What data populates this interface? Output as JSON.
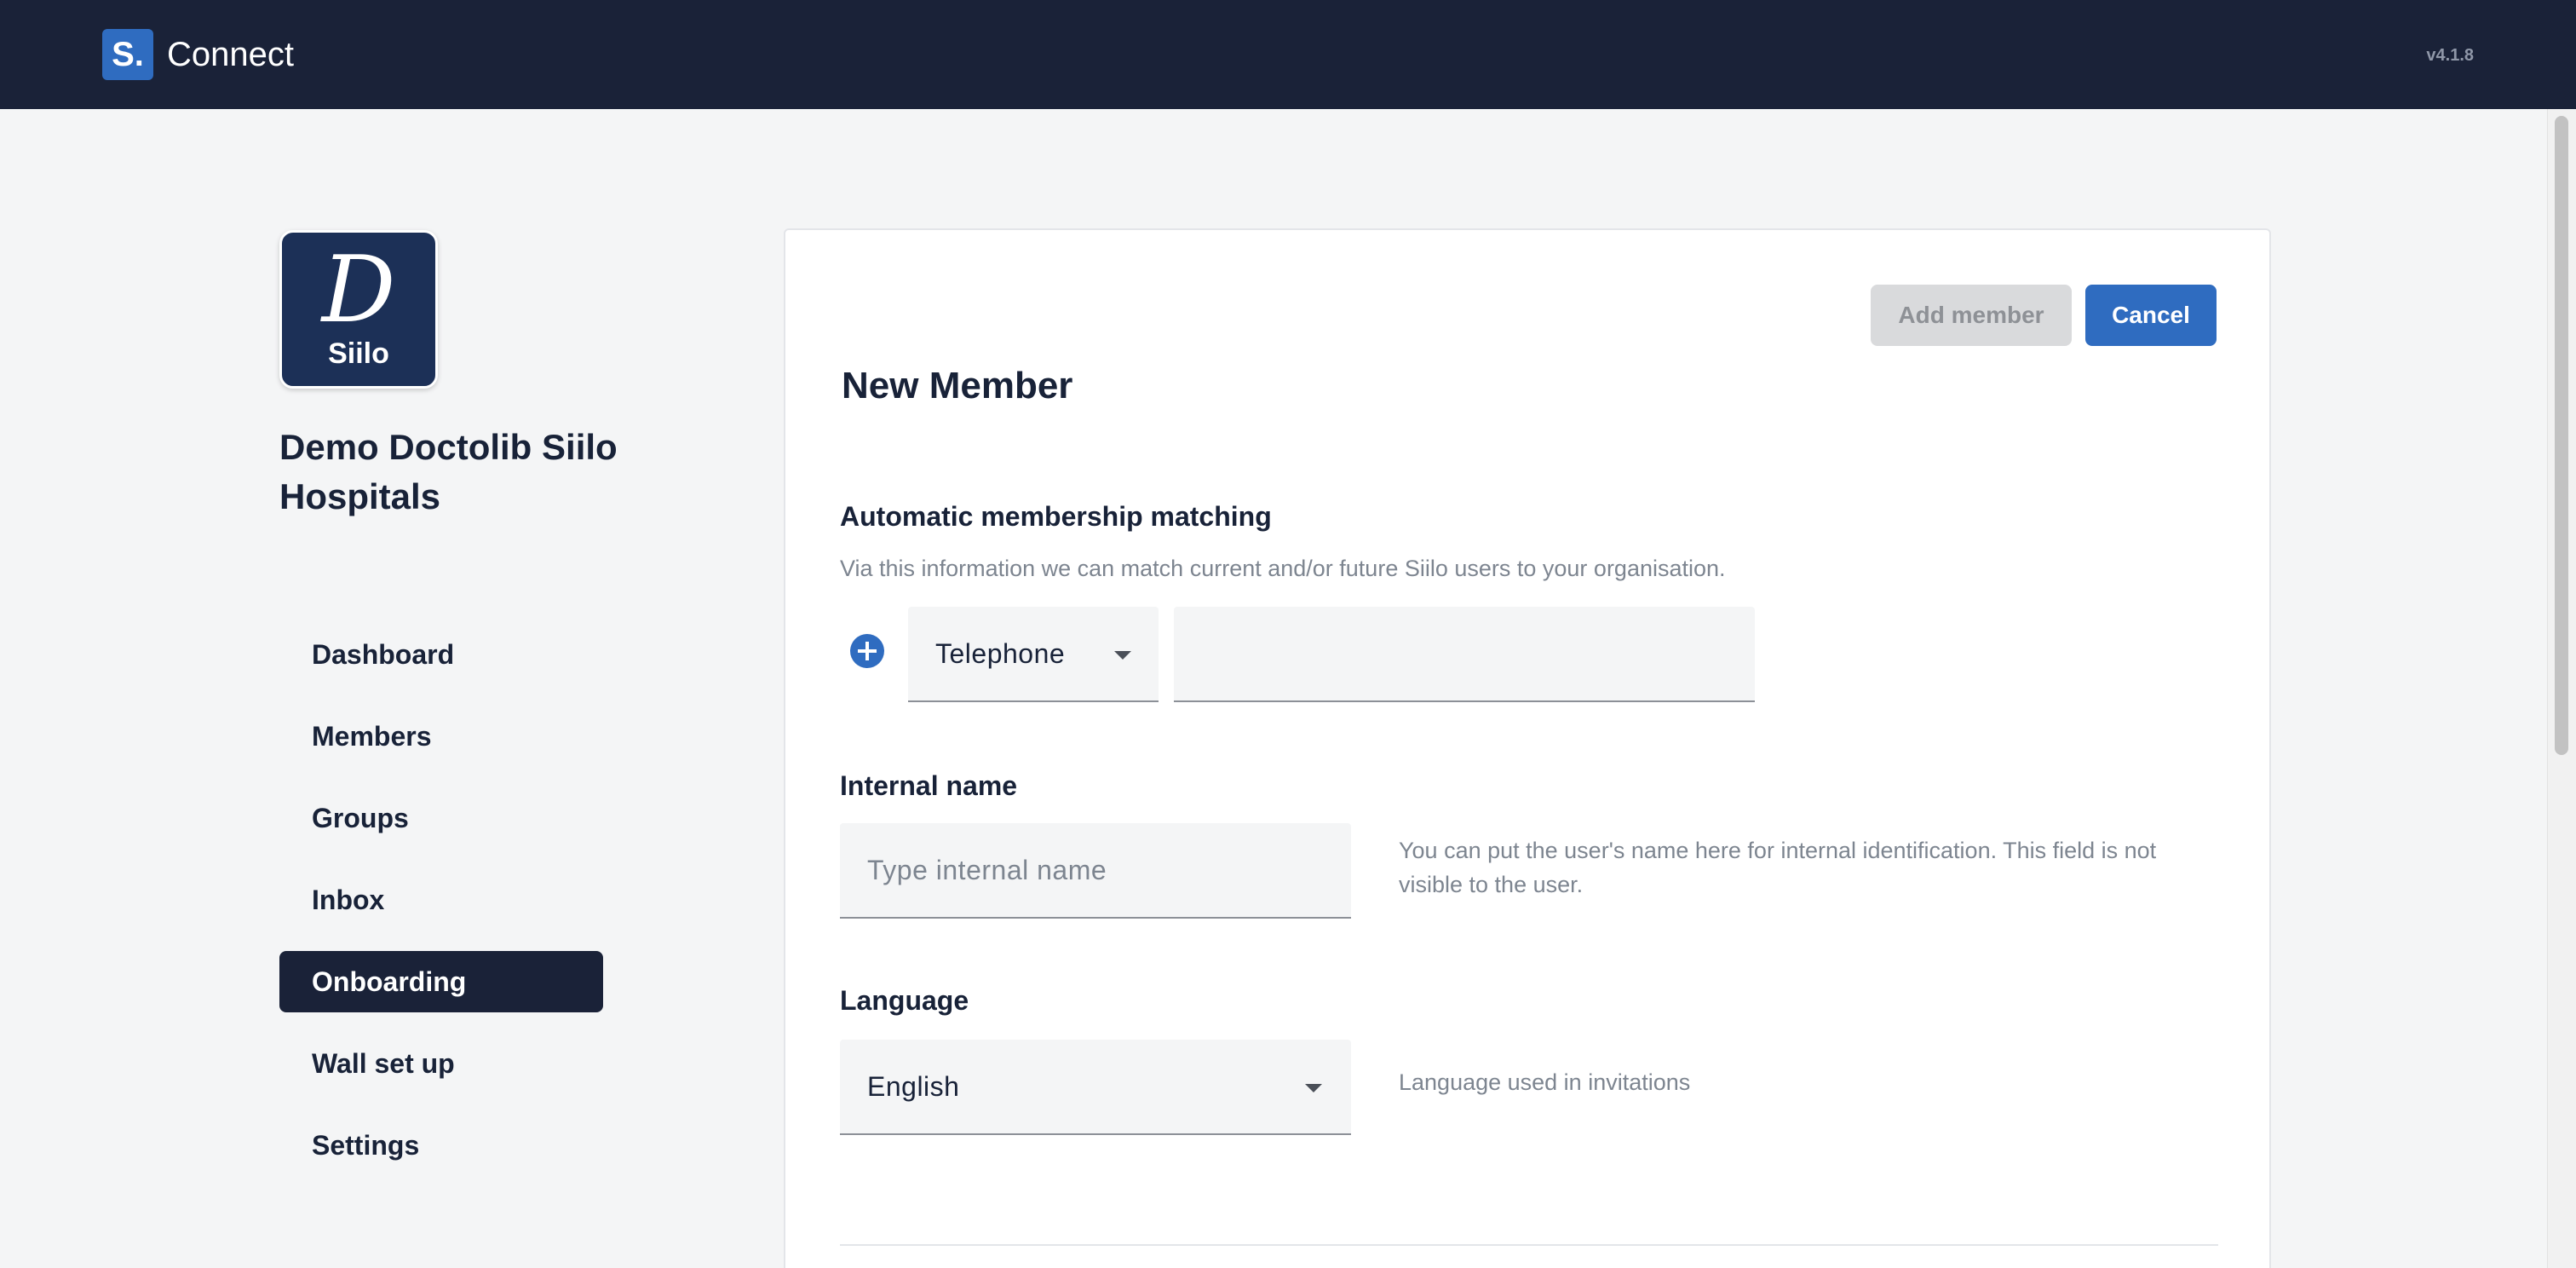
{
  "topbar": {
    "brand_mark": "S.",
    "brand_name": "Connect",
    "version": "v4.1.8"
  },
  "organisation": {
    "logo_letter": "D",
    "logo_word": "Siilo",
    "name": "Demo Doctolib Siilo Hospitals"
  },
  "nav": {
    "items": [
      {
        "label": "Dashboard"
      },
      {
        "label": "Members"
      },
      {
        "label": "Groups"
      },
      {
        "label": "Inbox"
      },
      {
        "label": "Onboarding",
        "active": true
      },
      {
        "label": "Wall set up"
      },
      {
        "label": "Settings"
      }
    ]
  },
  "form": {
    "title": "New Member",
    "add_button": "Add member",
    "cancel_button": "Cancel",
    "matching": {
      "label": "Automatic membership matching",
      "description": "Via this information we can match current and/or future Siilo users to your organisation.",
      "type_selected": "Telephone",
      "value": ""
    },
    "internal_name": {
      "label": "Internal name",
      "placeholder": "Type internal name",
      "value": "",
      "helper": "You can put the user's name here for internal identification.  This field is not visible to the user."
    },
    "language": {
      "label": "Language",
      "selected": "English",
      "helper": "Language used in invitations"
    }
  },
  "colors": {
    "topbar": "#1a2238",
    "primary": "#2f6cc0",
    "disabled": "#d9dadc",
    "background": "#f4f5f6"
  }
}
